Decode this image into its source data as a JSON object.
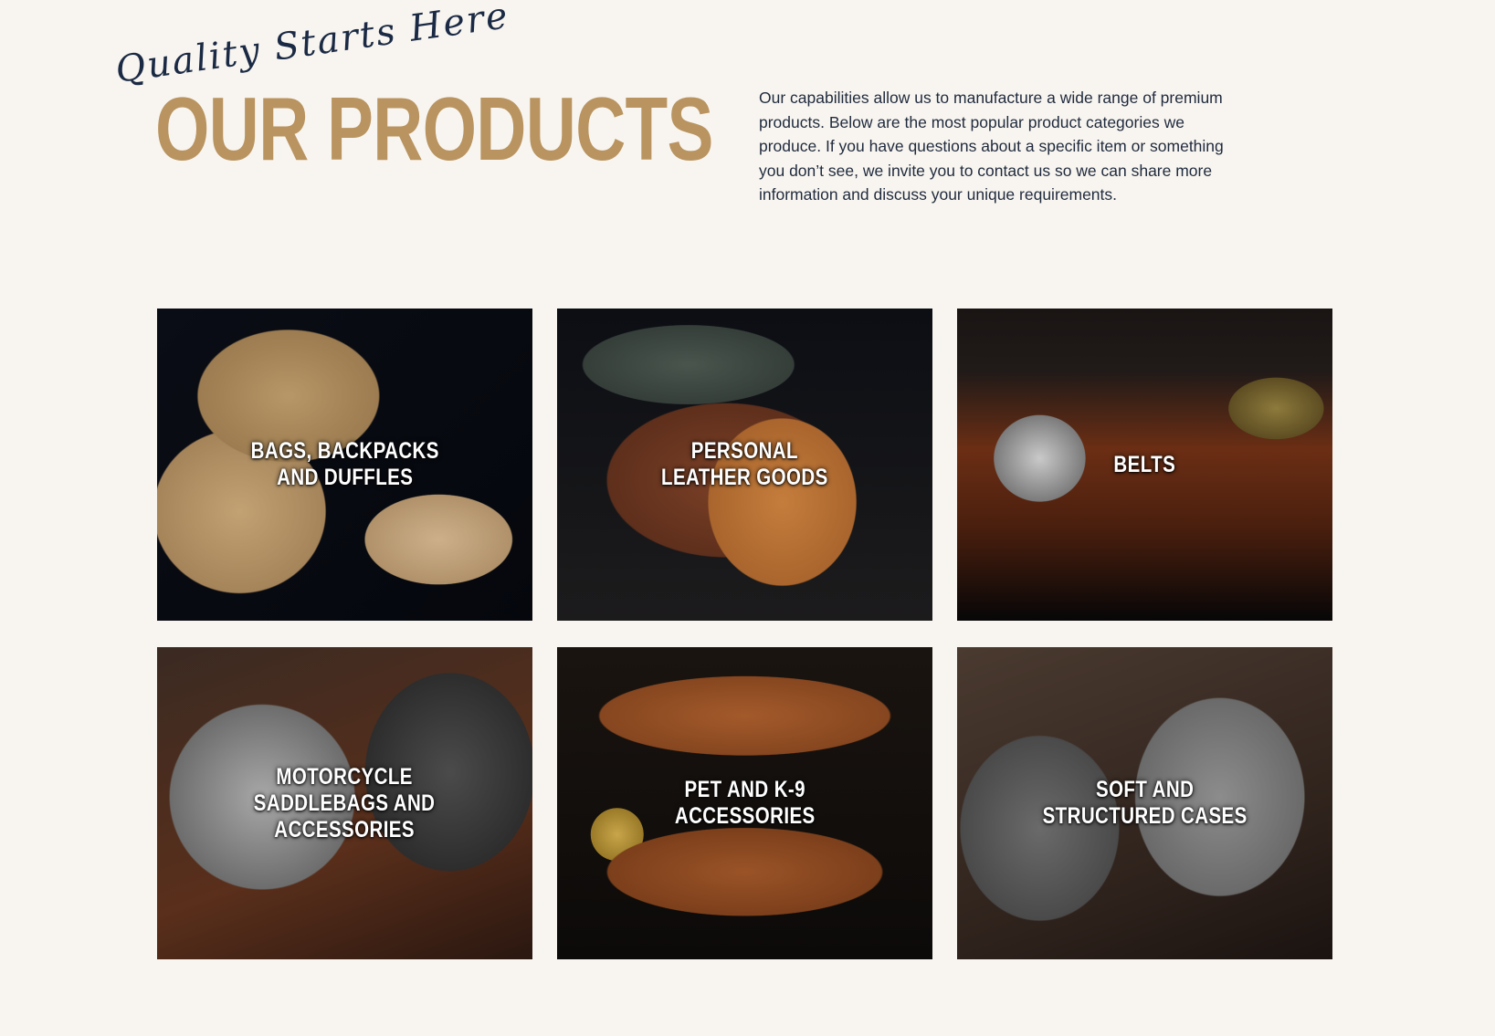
{
  "header": {
    "tagline": "Quality Starts Here",
    "title": "OUR PRODUCTS",
    "intro": "Our capabilities allow us to manufacture a wide range of premium products. Below are the most popular product categories we produce. If you have questions about a specific item or something you don’t see, we invite you to contact us so we can share more information and discuss your unique requirements."
  },
  "categories": [
    {
      "label": "BAGS, BACKPACKS\nAND DUFFLES"
    },
    {
      "label": "PERSONAL\nLEATHER GOODS"
    },
    {
      "label": "BELTS"
    },
    {
      "label": "MOTORCYCLE\nSADDLEBAGS AND\nACCESSORIES"
    },
    {
      "label": "PET AND K-9\nACCESSORIES"
    },
    {
      "label": "SOFT AND\nSTRUCTURED CASES"
    }
  ],
  "colors": {
    "background": "#f8f5f0",
    "title_gold": "#b99460",
    "script_navy": "#1b2a44",
    "body_text": "#1f2a3d"
  }
}
